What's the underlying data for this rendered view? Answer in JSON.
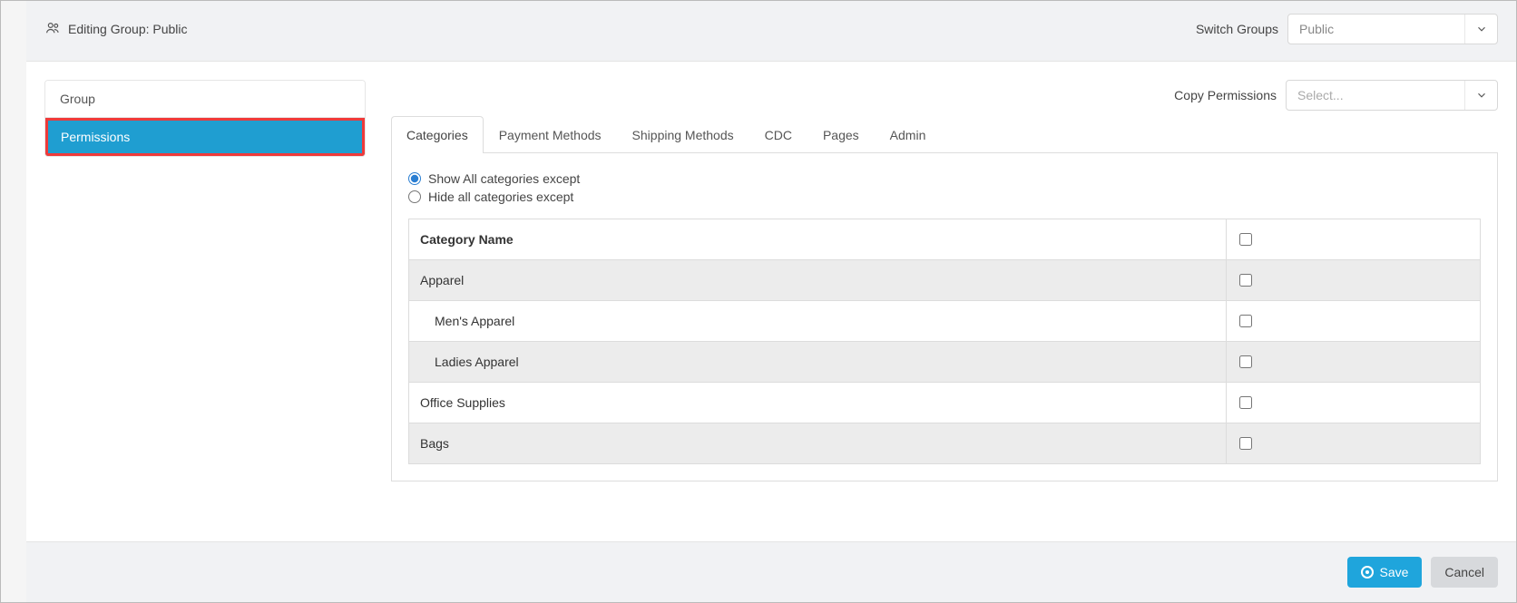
{
  "header": {
    "icon": "group-icon",
    "title": "Editing Group: Public",
    "switch_label": "Switch Groups",
    "switch_value": "Public"
  },
  "sidebar": {
    "items": [
      {
        "label": "Group",
        "active": false
      },
      {
        "label": "Permissions",
        "active": true
      }
    ]
  },
  "content": {
    "copy_label": "Copy Permissions",
    "copy_placeholder": "Select...",
    "tabs": [
      {
        "label": "Categories",
        "active": true
      },
      {
        "label": "Payment Methods",
        "active": false
      },
      {
        "label": "Shipping Methods",
        "active": false
      },
      {
        "label": "CDC",
        "active": false
      },
      {
        "label": "Pages",
        "active": false
      },
      {
        "label": "Admin",
        "active": false
      }
    ],
    "radios": {
      "show_label": "Show All categories except",
      "hide_label": "Hide all categories except",
      "selected": "show"
    },
    "table": {
      "header": "Category Name",
      "rows": [
        {
          "label": "Apparel",
          "indent": 0,
          "striped": true
        },
        {
          "label": "Men's Apparel",
          "indent": 1,
          "striped": false
        },
        {
          "label": "Ladies Apparel",
          "indent": 1,
          "striped": true
        },
        {
          "label": "Office Supplies",
          "indent": 0,
          "striped": false
        },
        {
          "label": "Bags",
          "indent": 0,
          "striped": true
        }
      ]
    }
  },
  "footer": {
    "save_label": "Save",
    "cancel_label": "Cancel"
  }
}
